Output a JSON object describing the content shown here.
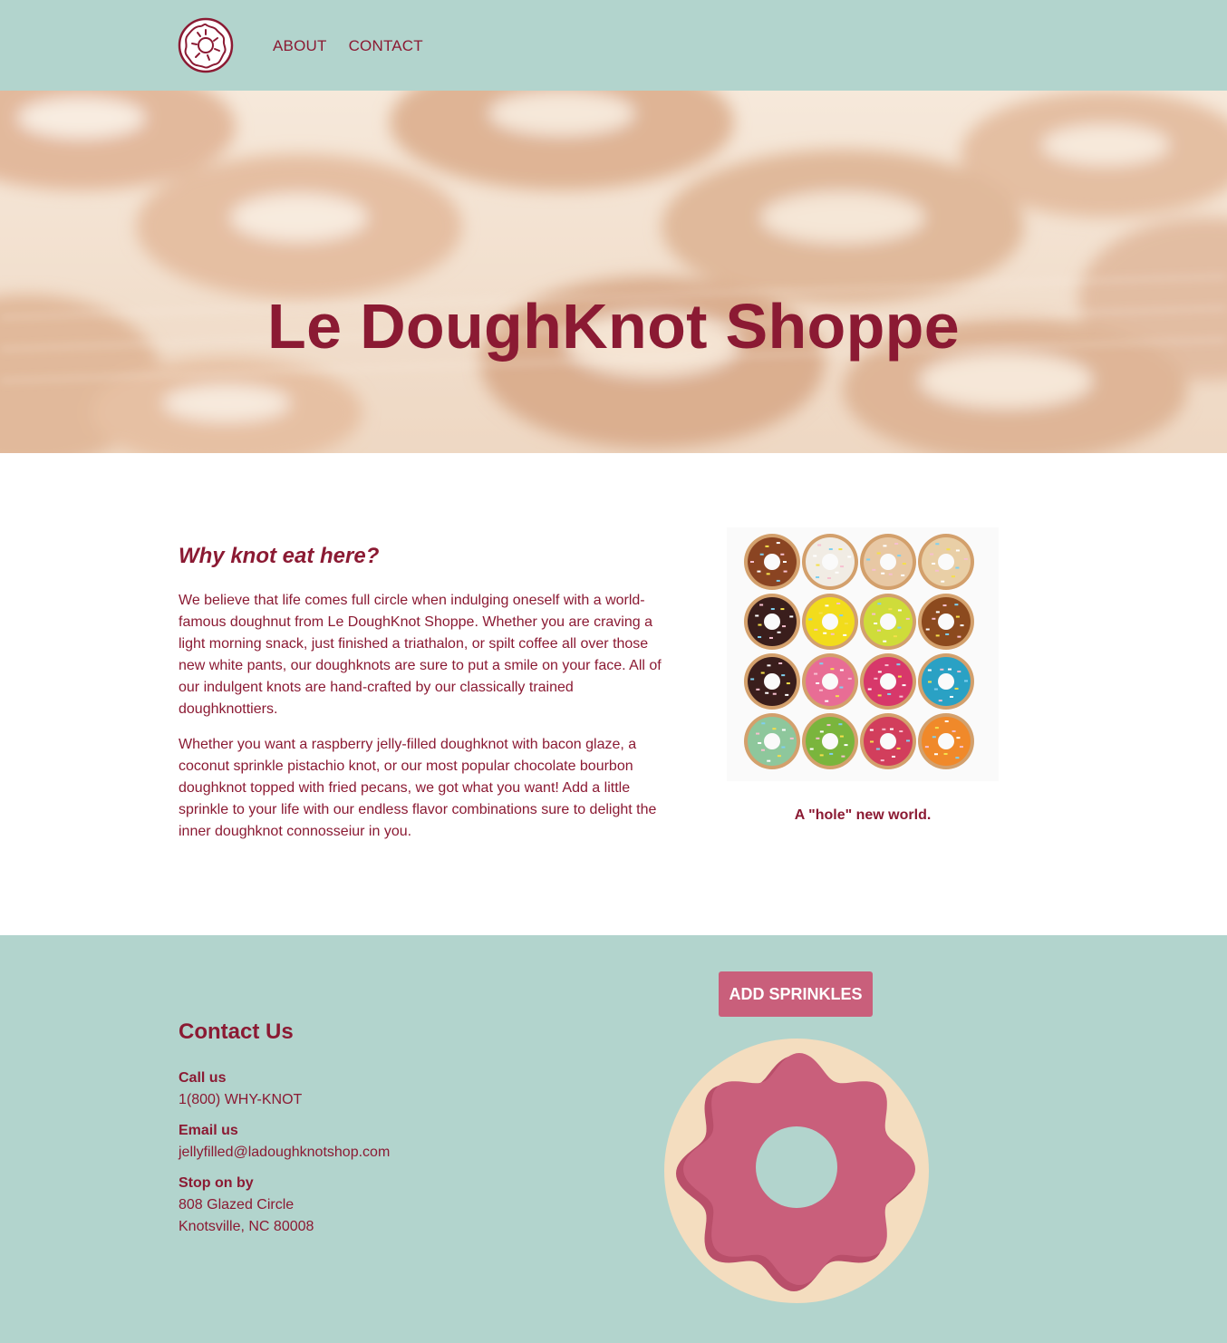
{
  "header": {
    "logo_icon": "donut-logo-icon",
    "nav": [
      {
        "label": "ABOUT"
      },
      {
        "label": "CONTACT"
      }
    ]
  },
  "hero": {
    "title": "Le DoughKnot Shoppe"
  },
  "about": {
    "heading": "Why knot eat here?",
    "paragraphs": [
      "We believe that life comes full circle when indulging oneself with a world-famous doughnut from Le DoughKnot Shoppe. Whether you are craving a light morning snack, just finished a triathalon, or spilt coffee all over those new white pants, our doughknots are sure to put a smile on your face. All of our indulgent knots are hand-crafted by our classically trained doughknottiers.",
      "Whether you want a raspberry jelly-filled doughknot with bacon glaze, a coconut sprinkle pistachio knot, or our most popular chocolate bourbon doughknot topped with fried pecans, we got what you want! Add a little sprinkle to your life with our endless flavor combinations sure to delight the inner doughknot connosseiur in you."
    ],
    "caption": "A \"hole\" new world."
  },
  "contact": {
    "heading": "Contact Us",
    "call_label": "Call us",
    "call_value": "1(800) WHY-KNOT",
    "email_label": "Email us",
    "email_value": "jellyfilled@ladoughknotshop.com",
    "visit_label": "Stop on by",
    "address_line1": "808 Glazed Circle",
    "address_line2": "Knotsville, NC 80008"
  },
  "button": {
    "label": "ADD SPRINKLES"
  },
  "colors": {
    "header_bg": "#b2d4cd",
    "brand_text": "#8b1a33",
    "button_bg": "#c95f7b",
    "donut_base": "#f4ddbf",
    "donut_icing": "#c95f7b"
  }
}
